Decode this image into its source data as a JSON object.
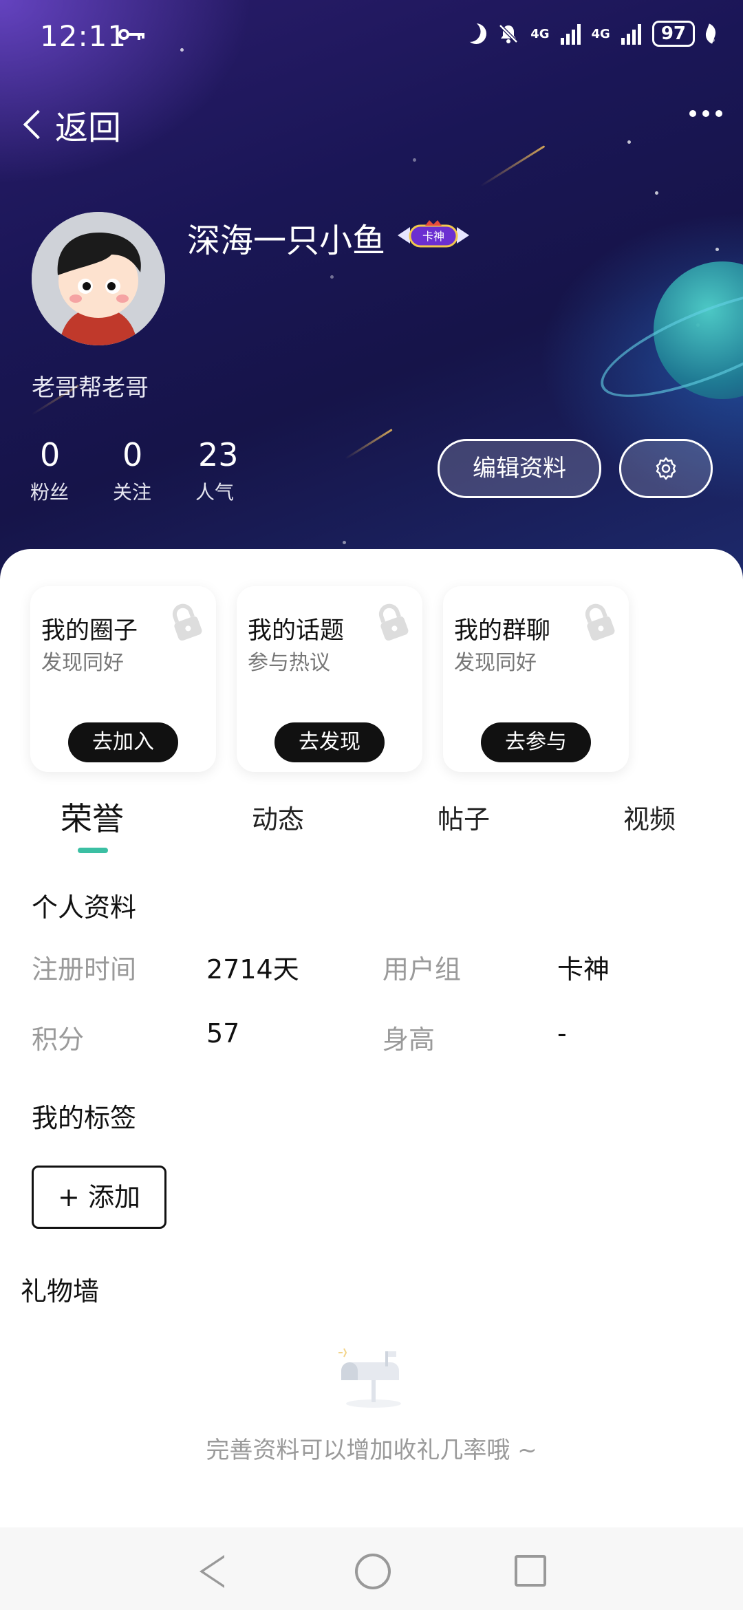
{
  "status_bar": {
    "time": "12:11",
    "network": "4G",
    "network2": "4G",
    "battery": "97"
  },
  "nav": {
    "back_label": "返回"
  },
  "profile": {
    "nickname": "深海一只小鱼",
    "badge_text": "卡神",
    "signature": "老哥帮老哥",
    "stats": [
      {
        "value": "0",
        "label": "粉丝"
      },
      {
        "value": "0",
        "label": "关注"
      },
      {
        "value": "23",
        "label": "人气"
      }
    ],
    "edit_button": "编辑资料"
  },
  "cards": [
    {
      "title": "我的圈子",
      "subtitle": "发现同好",
      "action": "去加入"
    },
    {
      "title": "我的话题",
      "subtitle": "参与热议",
      "action": "去发现"
    },
    {
      "title": "我的群聊",
      "subtitle": "发现同好",
      "action": "去参与"
    }
  ],
  "tabs": [
    "荣誉",
    "动态",
    "帖子",
    "视频"
  ],
  "active_tab": "荣誉",
  "accent_color": "#3bbfa3",
  "personal_info": {
    "title": "个人资料",
    "fields": [
      {
        "label": "注册时间",
        "value": "2714天"
      },
      {
        "label": "用户组",
        "value": "卡神"
      },
      {
        "label": "积分",
        "value": "57"
      },
      {
        "label": "身高",
        "value": "-"
      }
    ]
  },
  "tags": {
    "title": "我的标签",
    "add_button": "+ 添加"
  },
  "gift_wall": {
    "title": "礼物墙",
    "empty_text": "完善资料可以增加收礼几率哦 ~"
  }
}
